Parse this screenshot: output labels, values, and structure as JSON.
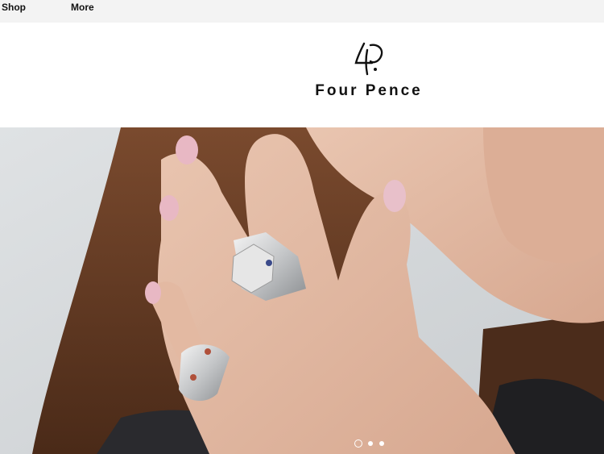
{
  "nav": {
    "shop_label": "Shop",
    "more_label": "More"
  },
  "brand": {
    "name": "Four Pence",
    "logo_icon": "four-pence-monogram-icon"
  },
  "hero": {
    "slide_count": 3,
    "active_slide": 1
  },
  "colors": {
    "nav_background": "#f3f3f3",
    "text": "#111111",
    "background": "#ffffff"
  }
}
